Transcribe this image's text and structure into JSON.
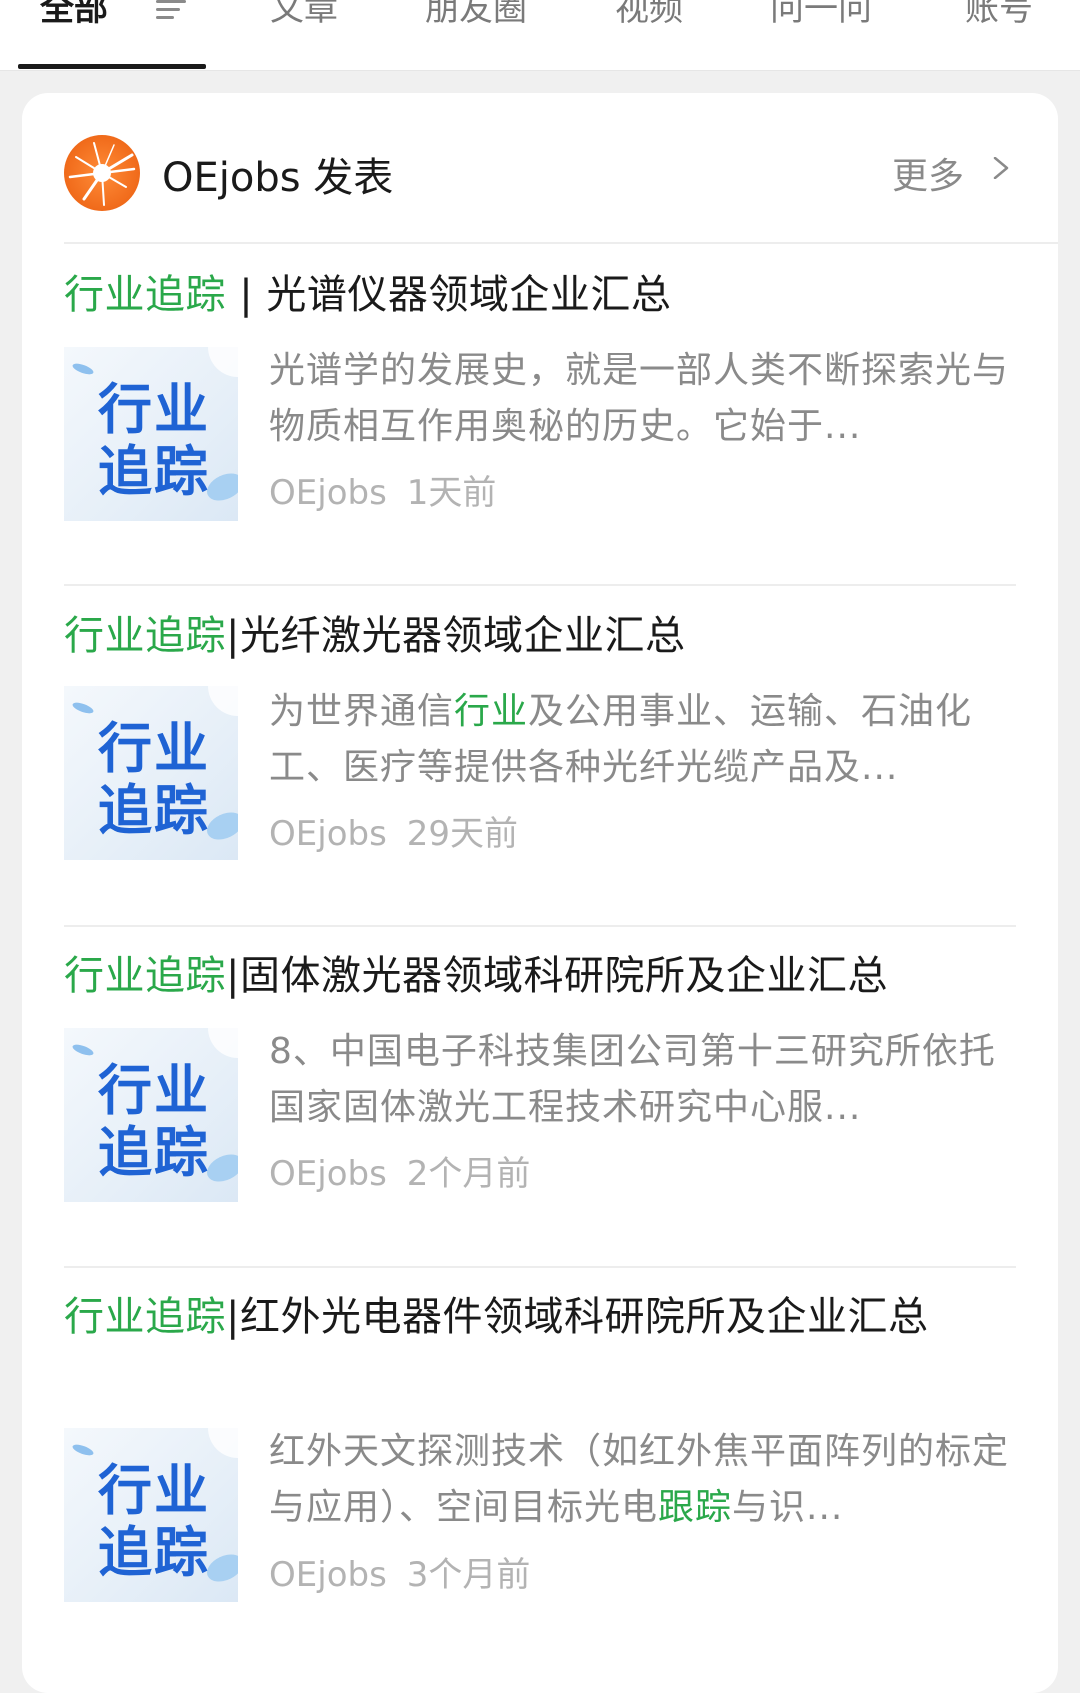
{
  "tabs": [
    {
      "label": "全部",
      "active": true
    },
    {
      "label": "文章",
      "active": false
    },
    {
      "label": "朋友圈",
      "active": false
    },
    {
      "label": "视频",
      "active": false
    },
    {
      "label": "问一问",
      "active": false
    },
    {
      "label": "账号",
      "active": false
    }
  ],
  "header": {
    "author_title": "OEjobs 发表",
    "more_label": "更多"
  },
  "thumb_text": "行业追踪",
  "articles": [
    {
      "title_tag": "行业追踪",
      "title_rest": " | 光谱仪器领域企业汇总",
      "summary_before": "光谱学的发展史，就是一部人类不断探索光与物质相互作用奥秘的历史。它始于...",
      "summary_keyword": "",
      "summary_after": "",
      "author": "OEjobs",
      "time": "1天前"
    },
    {
      "title_tag": "行业追踪",
      "title_rest": "|光纤激光器领域企业汇总",
      "summary_before": "为世界通信",
      "summary_keyword": "行业",
      "summary_after": "及公用事业、运输、石油化工、医疗等提供各种光纤光缆产品及...",
      "author": "OEjobs",
      "time": "29天前"
    },
    {
      "title_tag": "行业追踪",
      "title_rest": "|固体激光器领域科研院所及企业汇总",
      "summary_before": "8、中国电子科技集团公司第十三研究所依托国家固体激光工程技术研究中心服...",
      "summary_keyword": "",
      "summary_after": "",
      "author": "OEjobs",
      "time": "2个月前"
    },
    {
      "title_tag": "行业追踪",
      "title_rest": "|红外光电器件领域科研院所及企业汇总",
      "summary_before": "红外天文探测技术（如红外焦平面阵列的标定与应用）、空间目标光电",
      "summary_keyword": "跟踪",
      "summary_after": "与识...",
      "author": "OEjobs",
      "time": "3个月前"
    }
  ],
  "colors": {
    "accent_green": "#2aa84a",
    "thumb_blue": "#1f63d4",
    "avatar_orange": "#f06a1a"
  }
}
